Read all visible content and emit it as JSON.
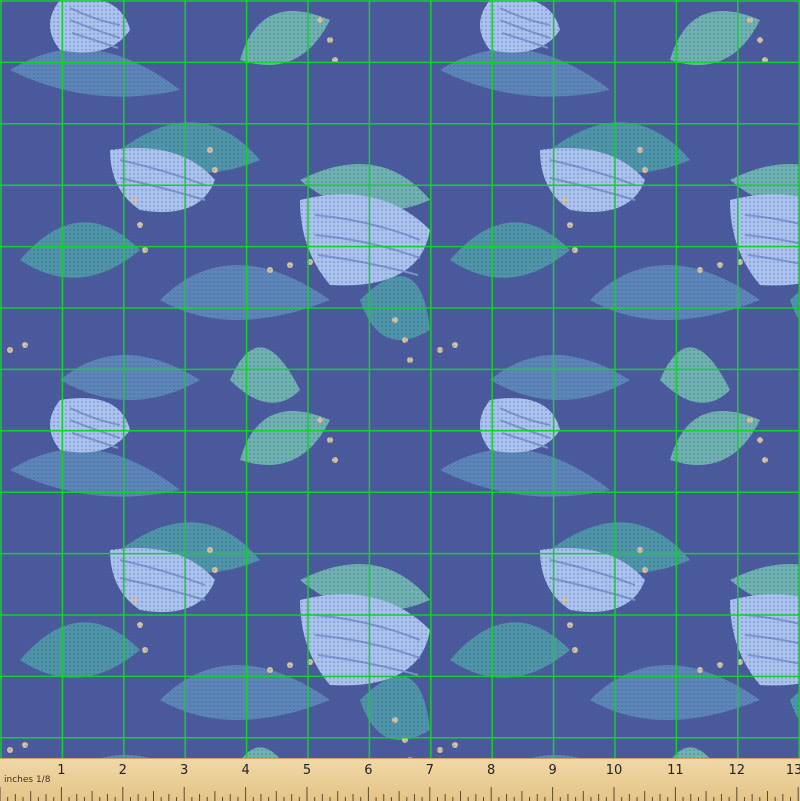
{
  "fabric": {
    "background_color": "#4a5a9c",
    "grid_color": "#13d02c",
    "leaf_colors": [
      "#5c86b8",
      "#4e95a8",
      "#6fb3b0"
    ],
    "petal_color": "#a9c2ee",
    "petal_line_color": "#7b96cf",
    "dot_color": "#d4c3a0"
  },
  "ruler": {
    "unit_label": "inches 1/8",
    "numbers": [
      "1",
      "2",
      "3",
      "4",
      "5",
      "6",
      "7",
      "8",
      "9",
      "10",
      "11",
      "12",
      "13"
    ]
  }
}
